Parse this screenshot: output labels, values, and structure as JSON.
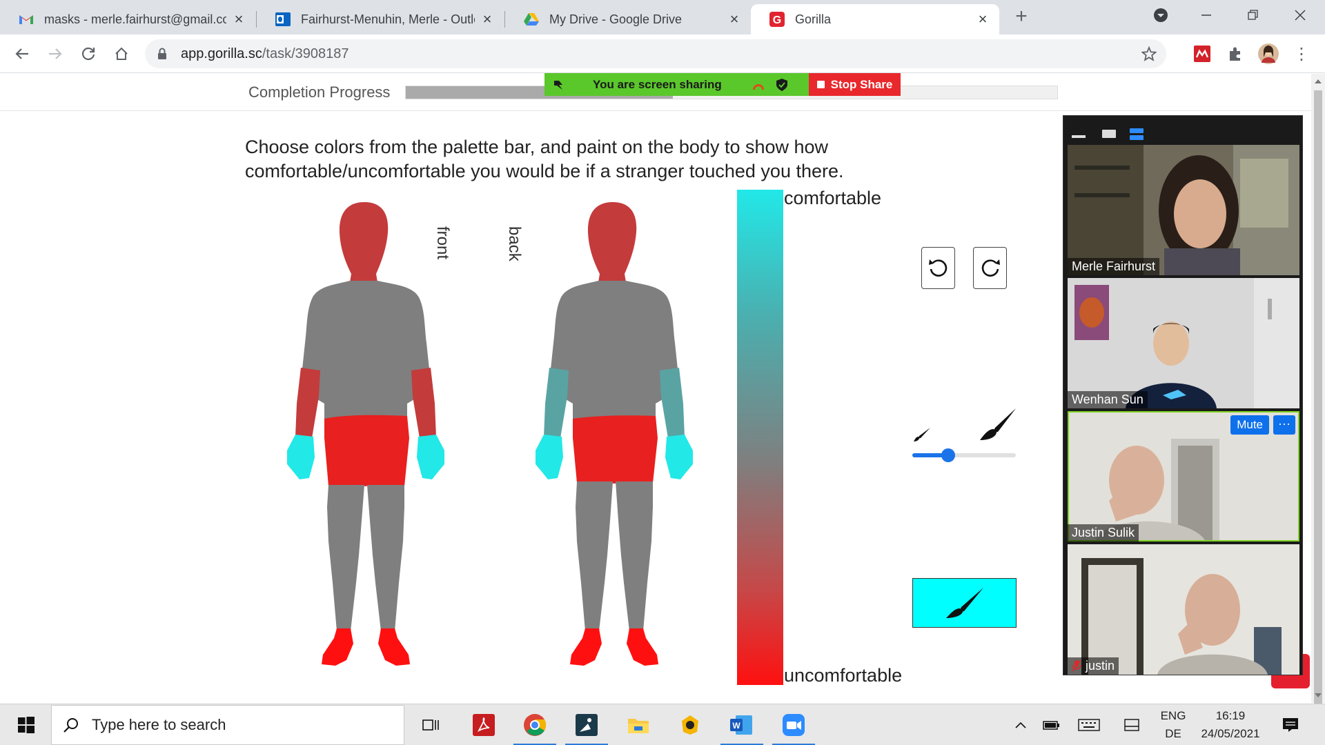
{
  "browser": {
    "tabs": [
      {
        "title": "masks - merle.fairhurst@gmail.co",
        "icon": "gmail-icon",
        "active": false
      },
      {
        "title": "Fairhurst-Menuhin, Merle - Outlo",
        "icon": "outlook-icon",
        "active": false
      },
      {
        "title": "My Drive - Google Drive",
        "icon": "google-drive-icon",
        "active": false
      },
      {
        "title": "Gorilla",
        "icon": "gorilla-icon",
        "active": true
      }
    ],
    "url_domain": "app.gorilla.sc",
    "url_path": "/task/3908187"
  },
  "screen_share": {
    "status": "You are screen sharing",
    "stop_label": "Stop Share"
  },
  "task": {
    "progress_label": "Completion Progress",
    "progress_fraction": 0.41,
    "instructions_line1": "Choose colors from the palette bar, and paint on the body to show how",
    "instructions_line2": "comfortable/uncomfortable you would be if a stranger touched you there.",
    "front_label": "front",
    "back_label": "back",
    "palette_top_label": "comfortable",
    "palette_bottom_label": "uncomfortable",
    "brush_size_fraction": 0.32,
    "selected_color": "#00ffff"
  },
  "zoom": {
    "participants": [
      {
        "name": "Merle Fairhurst",
        "muted": false,
        "speaking": false
      },
      {
        "name": "Wenhan Sun",
        "muted": false,
        "speaking": false
      },
      {
        "name": "Justin Sulik",
        "muted": false,
        "speaking": true
      },
      {
        "name": "justin",
        "muted": true,
        "speaking": false
      }
    ],
    "mute_label": "Mute",
    "more_label": "···"
  },
  "taskbar": {
    "search_placeholder": "Type here to search",
    "lang_top": "ENG",
    "lang_bottom": "DE",
    "time": "16:19",
    "date": "24/05/2021"
  },
  "colors": {
    "comfortable": "#22e8e8",
    "neutral": "#7f7f7f",
    "uncomfortable": "#ff1010",
    "painted_red": "#e8201f",
    "painted_dark_red": "#c43b3b",
    "painted_teal": "#5aa3a3"
  }
}
